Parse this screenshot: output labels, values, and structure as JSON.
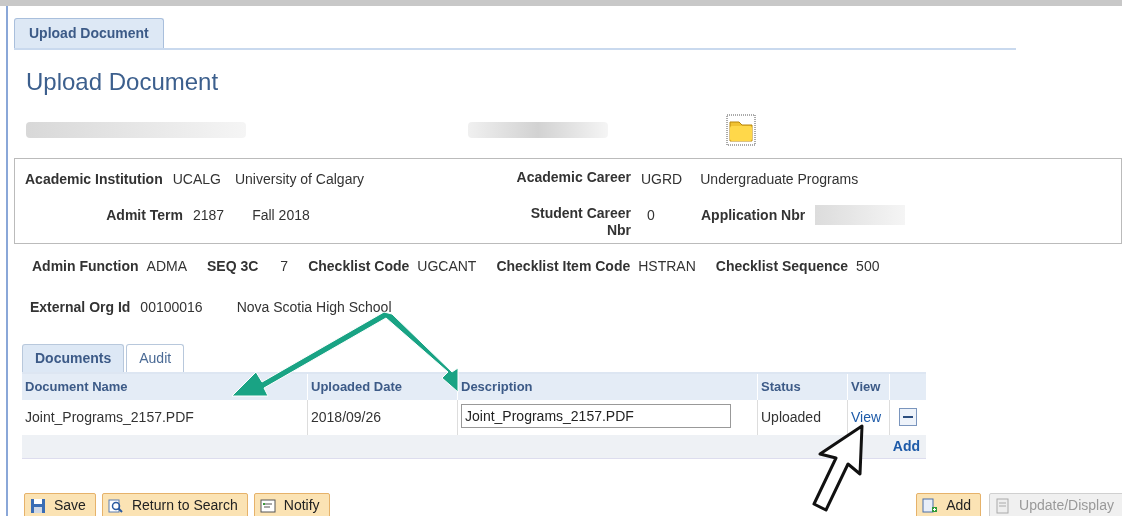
{
  "page_tab": {
    "label": "Upload Document",
    "selected": true
  },
  "title": "Upload Document",
  "header_fields": [
    {
      "label": "Academic Institution",
      "code": "UCALG",
      "value": "University of Calgary"
    },
    {
      "label": "Academic Career",
      "code": "UGRD",
      "value": "Undergraduate Programs"
    },
    {
      "label": "Admit Term",
      "code": "2187",
      "value": "Fall 2018"
    },
    {
      "label": "Student Career Nbr",
      "code": "0"
    },
    {
      "label": "Application Nbr"
    }
  ],
  "checklist_fields": [
    {
      "label": "Admin Function",
      "value": "ADMA"
    },
    {
      "label": "SEQ 3C",
      "value": "7"
    },
    {
      "label": "Checklist Code",
      "value": "UGCANT"
    },
    {
      "label": "Checklist Item Code",
      "value": "HSTRAN"
    },
    {
      "label": "Checklist Sequence",
      "value": "500"
    }
  ],
  "external_org": {
    "label": "External Org Id",
    "code": "00100016",
    "name": "Nova Scotia High School"
  },
  "grid_tabs": [
    {
      "label": "Documents",
      "selected": true
    },
    {
      "label": "Audit",
      "selected": false
    }
  ],
  "table": {
    "columns": [
      "Document Name",
      "Uploaded Date",
      "Description",
      "Status",
      "View"
    ],
    "rows": [
      {
        "document_name": "Joint_Programs_2157.PDF",
        "uploaded_date": "2018/09/26",
        "description": "Joint_Programs_2157.PDF",
        "status": "Uploaded",
        "view": "View"
      }
    ],
    "add_link": "Add"
  },
  "buttons": [
    {
      "label": "Save",
      "kind": "save",
      "disabled": false
    },
    {
      "label": "Return to Search",
      "kind": "search",
      "disabled": false
    },
    {
      "label": "Notify",
      "kind": "notify",
      "disabled": false
    }
  ],
  "right_buttons": [
    {
      "label": "Add",
      "kind": "add",
      "disabled": false
    },
    {
      "label": "Update/Display",
      "kind": "update",
      "disabled": true
    }
  ]
}
